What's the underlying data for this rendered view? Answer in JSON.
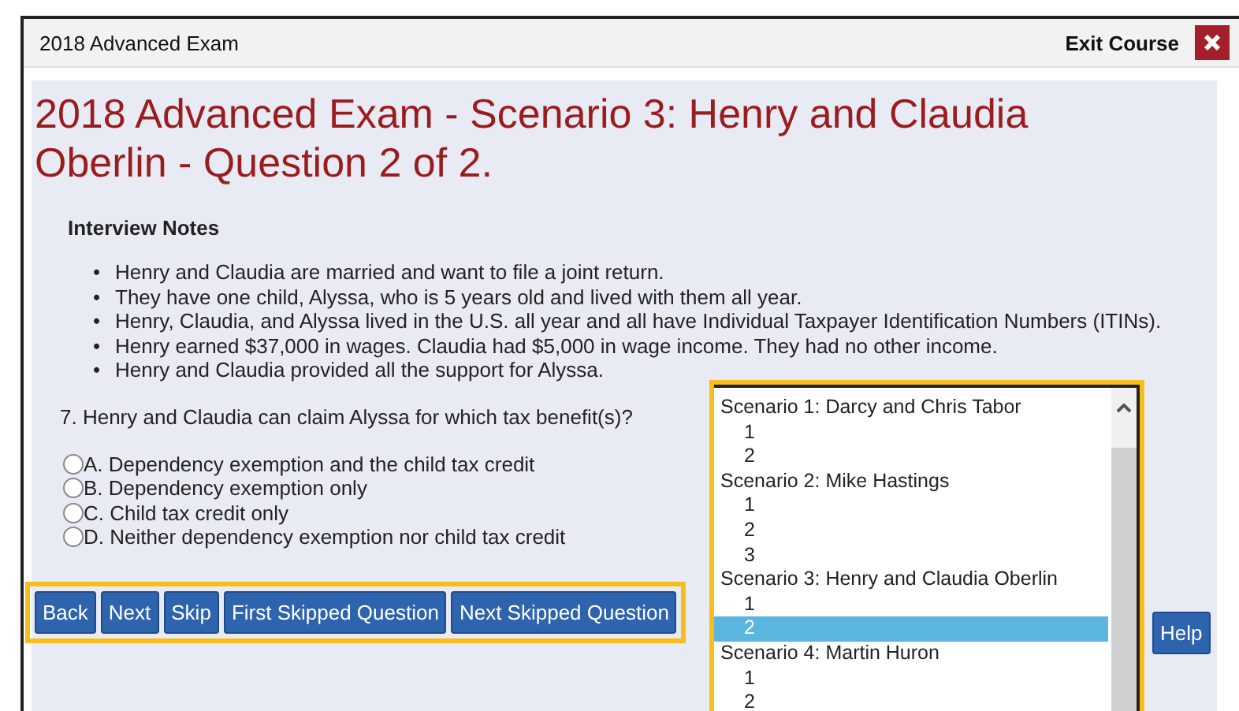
{
  "window": {
    "title": "2018 Advanced Exam",
    "exit_label": "Exit Course"
  },
  "heading": "2018 Advanced Exam - Scenario 3: Henry and Claudia Oberlin - Question 2 of 2.",
  "notes": {
    "title": "Interview Notes",
    "marker": "•",
    "items": [
      "Henry and Claudia are married and want to file a joint return.",
      "They have one child, Alyssa, who is 5 years old and lived with them all year.",
      "Henry, Claudia, and Alyssa lived in the U.S. all year and all have Individual Taxpayer Identification Numbers (ITINs).",
      "Henry earned $37,000 in wages. Claudia had $5,000 in wage income. They had no other income.",
      "Henry and Claudia provided all the support for Alyssa."
    ]
  },
  "question": "7. Henry and Claudia can claim Alyssa for which tax benefit(s)?",
  "options": [
    {
      "label": "A. Dependency exemption and the child tax credit",
      "selected": false
    },
    {
      "label": "B. Dependency exemption only",
      "selected": false
    },
    {
      "label": "C. Child tax credit only",
      "selected": false
    },
    {
      "label": "D. Neither dependency exemption nor child tax credit",
      "selected": false
    }
  ],
  "nav_buttons": [
    "Back",
    "Next",
    "Skip",
    "First Skipped Question",
    "Next Skipped Question"
  ],
  "help_button": "Help",
  "question_list": [
    {
      "label": "Scenario 1: Darcy and Chris Tabor",
      "selected": false,
      "children": [
        {
          "label": "1",
          "selected": false
        },
        {
          "label": "2",
          "selected": false
        }
      ]
    },
    {
      "label": "Scenario 2: Mike Hastings",
      "selected": false,
      "children": [
        {
          "label": "1",
          "selected": false
        },
        {
          "label": "2",
          "selected": false
        },
        {
          "label": "3",
          "selected": false
        }
      ]
    },
    {
      "label": "Scenario 3: Henry and Claudia Oberlin",
      "selected": false,
      "children": [
        {
          "label": "1",
          "selected": false
        },
        {
          "label": "2",
          "selected": true
        }
      ]
    },
    {
      "label": "Scenario 4: Martin Huron",
      "selected": false,
      "children": [
        {
          "label": "1",
          "selected": false
        },
        {
          "label": "2",
          "selected": false
        }
      ]
    }
  ]
}
